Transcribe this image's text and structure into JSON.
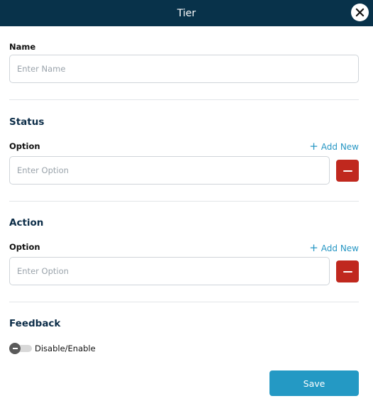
{
  "header": {
    "title": "Tier",
    "close_icon": "close-icon"
  },
  "name_field": {
    "label": "Name",
    "placeholder": "Enter Name",
    "value": ""
  },
  "status": {
    "title": "Status",
    "option_label": "Option",
    "add_new_label": "Add New",
    "option_placeholder": "Enter Option",
    "option_value": ""
  },
  "action": {
    "title": "Action",
    "option_label": "Option",
    "add_new_label": "Add New",
    "option_placeholder": "Enter Option",
    "option_value": ""
  },
  "feedback": {
    "title": "Feedback",
    "toggle_label": "Disable/Enable",
    "enabled": false
  },
  "footer": {
    "save_label": "Save"
  },
  "colors": {
    "header_bg": "#08324a",
    "accent": "#2499c4",
    "danger": "#c0281e",
    "section_title": "#0c2d48"
  }
}
